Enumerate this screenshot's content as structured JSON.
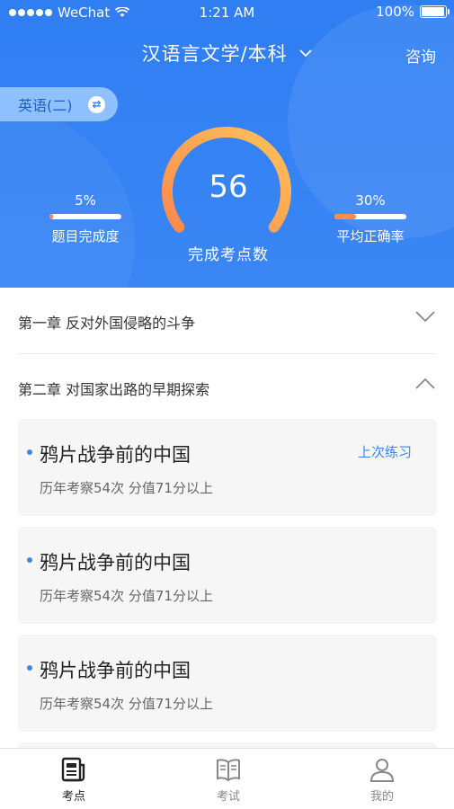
{
  "status_bar": {
    "carrier": "WeChat",
    "time": "1:21 AM",
    "battery": "100%"
  },
  "header": {
    "title": "汉语言文学/本科",
    "consult_label": "咨询",
    "subject_pill": "英语(二)"
  },
  "progress": {
    "completed_points": "56",
    "completed_label": "完成考点数",
    "gauge_fraction": 0.56,
    "question_completion": {
      "percent": "5%",
      "value": 0.05,
      "label": "题目完成度"
    },
    "avg_accuracy": {
      "percent": "30%",
      "value": 0.3,
      "label": "平均正确率"
    }
  },
  "chapters": [
    {
      "title": "第一章  反对外国侵略的斗争",
      "expanded": false
    },
    {
      "title": "第二章  对国家出路的早期探索",
      "expanded": true
    }
  ],
  "cards": [
    {
      "title": "鸦片战争前的中国",
      "meta": "历年考察54次 分值71分以上",
      "tag": "上次练习"
    },
    {
      "title": "鸦片战争前的中国",
      "meta": "历年考察54次 分值71分以上"
    },
    {
      "title": "鸦片战争前的中国",
      "meta": "历年考察54次 分值71分以上"
    }
  ],
  "tabbar": {
    "items": [
      {
        "label": "考点",
        "icon": "newspaper-icon",
        "active": true
      },
      {
        "label": "考试",
        "icon": "book-icon",
        "active": false
      },
      {
        "label": "我的",
        "icon": "person-icon",
        "active": false
      }
    ]
  },
  "colors": {
    "brand_blue": "#3a86f5",
    "accent_orange": "#ff8a4c"
  }
}
